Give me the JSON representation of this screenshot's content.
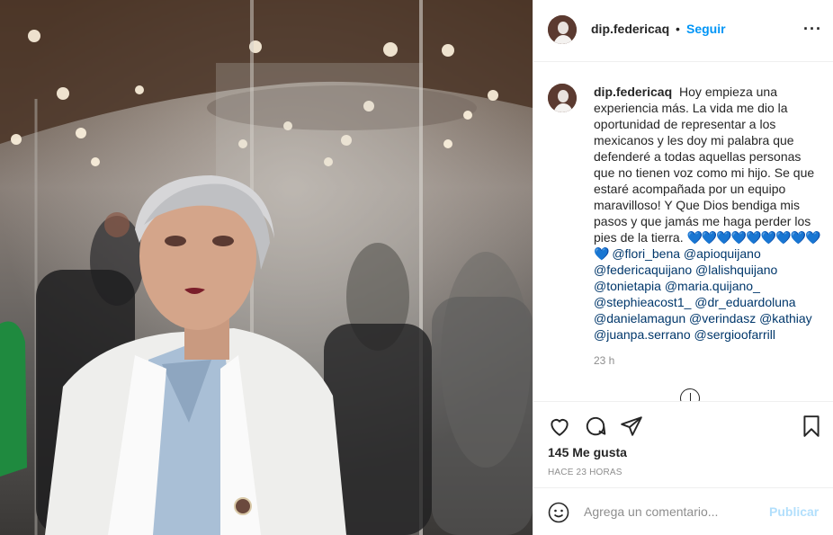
{
  "post": {
    "username": "dip.federicaq",
    "separator": "•",
    "follow_label": "Seguir",
    "more_icon": "more-horizontal-icon",
    "caption_username": "dip.federicaq",
    "caption_text": "Hoy empieza una experiencia más. La vida me dio la oportunidad de representar a los mexicanos y les doy mi palabra que defenderé a todas aquellas personas que no tienen voz como mi hijo. Se que estaré acompañada por un equipo maravilloso! Y Que Dios bendiga mis pasos y que jamás me haga perder los pies de la tierra.",
    "caption_hearts": "💙💙💙💙💙💙💙💙💙💙",
    "mentions": "@flori_bena @apioquijano @federicaquijano @lalishquijano @tonietapia @maria.quijano_ @stephieacost1_ @dr_eduardoluna @danielamagun @verindasz @kathiay @juanpa.serrano @sergioofarrill",
    "caption_time": "23 h",
    "likes": "145 Me gusta",
    "posted_ago": "HACE 23 HORAS",
    "comment_placeholder": "Agrega un comentario...",
    "publish_label": "Publicar"
  },
  "icons": {
    "like": "heart-icon",
    "comment": "comment-icon",
    "share": "paper-plane-icon",
    "save": "bookmark-icon",
    "emoji": "smiley-icon",
    "load_more": "plus-circle-icon"
  },
  "colors": {
    "link_blue": "#0095f6",
    "publish_disabled": "#b2dffc",
    "text": "#262626",
    "muted": "#8e8e8e",
    "border": "#efefef"
  }
}
